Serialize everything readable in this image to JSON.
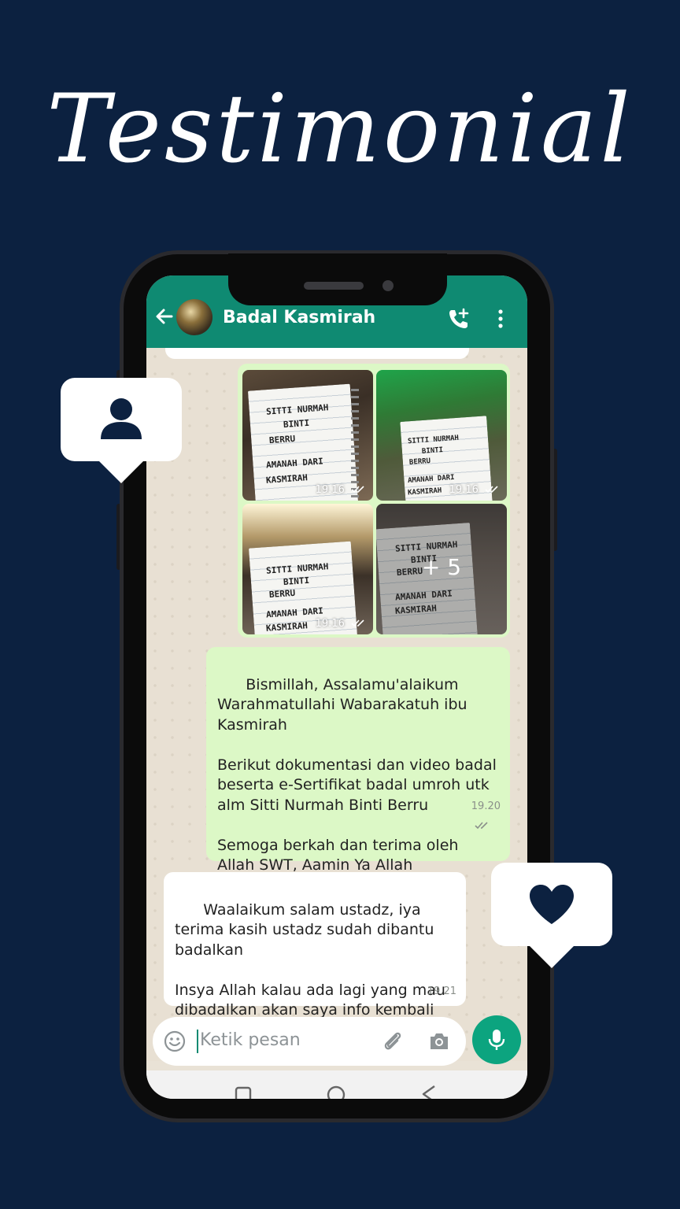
{
  "title": "Testimonial",
  "header": {
    "contact_name": "Badal Kasmirah"
  },
  "media": {
    "thumbs": [
      {
        "time": "19.16",
        "note_lines": [
          "SITTI NURMAH",
          "BINTI",
          "BERRU",
          "AMANAH DARI",
          "KASMIRAH"
        ]
      },
      {
        "time": "19.16",
        "note_lines": [
          "SITTI NURMAH",
          "BINTI",
          "BERRU",
          "AMANAH DARI",
          "KASMIRAH"
        ]
      },
      {
        "time": "19.16",
        "note_lines": [
          "SITTI NURMAH",
          "BINTI",
          "BERRU",
          "AMANAH DARI",
          "KASMIRAH"
        ]
      },
      {
        "time": "",
        "note_lines": [
          "SITTI NURMAH",
          "BINTI",
          "BERRU",
          "AMANAH DARI",
          "KASMIRAH"
        ],
        "more": "+ 5"
      }
    ]
  },
  "messages": [
    {
      "direction": "out",
      "text": "Bismillah, Assalamu'alaikum Warahmatullahi Wabarakatuh ibu Kasmirah\n\nBerikut dokumentasi dan video badal beserta e-Sertifikat badal umroh utk alm Sitti Nurmah Binti Berru\n\nSemoga berkah dan terima oleh Allah SWT, Aamin Ya Allah",
      "time": "19.20"
    },
    {
      "direction": "in",
      "text": "Waalaikum salam ustadz, iya terima kasih ustadz sudah dibantu badalkan\n\nInsya Allah kalau ada lagi yang mau dibadalkan akan saya info kembali ustadz",
      "time": "19.21"
    }
  ],
  "input": {
    "placeholder": "Ketik pesan"
  },
  "icons": {
    "back": "arrow-left-icon",
    "call": "add-call-icon",
    "menu": "more-vertical-icon",
    "emoji": "emoji-icon",
    "attach": "paperclip-icon",
    "camera": "camera-icon",
    "mic": "mic-icon",
    "user_card": "user-icon",
    "heart_card": "heart-icon"
  },
  "colors": {
    "background": "#0c2140",
    "header": "#0f8a72",
    "outgoing_bubble": "#dcf8c6",
    "incoming_bubble": "#ffffff",
    "mic_button": "#0ca47f",
    "card_icon": "#0c2140"
  }
}
